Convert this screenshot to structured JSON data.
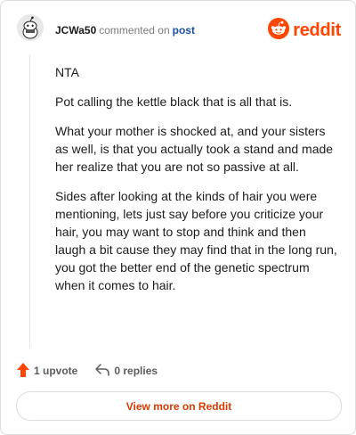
{
  "header": {
    "username": "JCWa50",
    "action": "commented on",
    "post_link": "post",
    "brand": "reddit"
  },
  "comment": {
    "paragraphs": [
      "NTA",
      "Pot calling the kettle black that is all that is.",
      "What your mother is shocked at, and your sisters as well, is that you actually took a stand and made her realize that you are not so passive at all.",
      "Sides after looking at the kinds of hair you were mentioning, lets just say before you criticize your hair, you may want to stop and think and then laugh a bit cause they may find that in the long run, you got the better end of the genetic spectrum when it comes to hair."
    ]
  },
  "actions": {
    "upvote_label": "1 upvote",
    "replies_label": "0 replies"
  },
  "footer": {
    "view_more": "View more on Reddit"
  },
  "colors": {
    "brand": "#ff4500",
    "upvote": "#ff4500",
    "link": "#d93a00"
  },
  "icons": [
    "snoo-avatar-icon",
    "reddit-logo-icon",
    "upvote-arrow-icon",
    "reply-icon"
  ]
}
